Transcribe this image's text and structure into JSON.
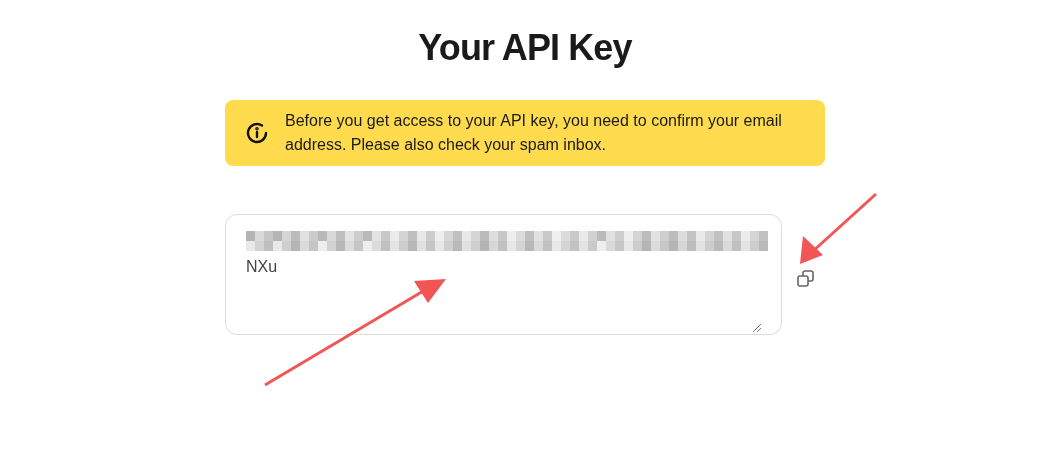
{
  "title": "Your API Key",
  "notice": {
    "text": "Before you get access to your API key, you need to confirm your email address. Please also check your spam inbox."
  },
  "api_key_field": {
    "value": "NXu"
  }
}
